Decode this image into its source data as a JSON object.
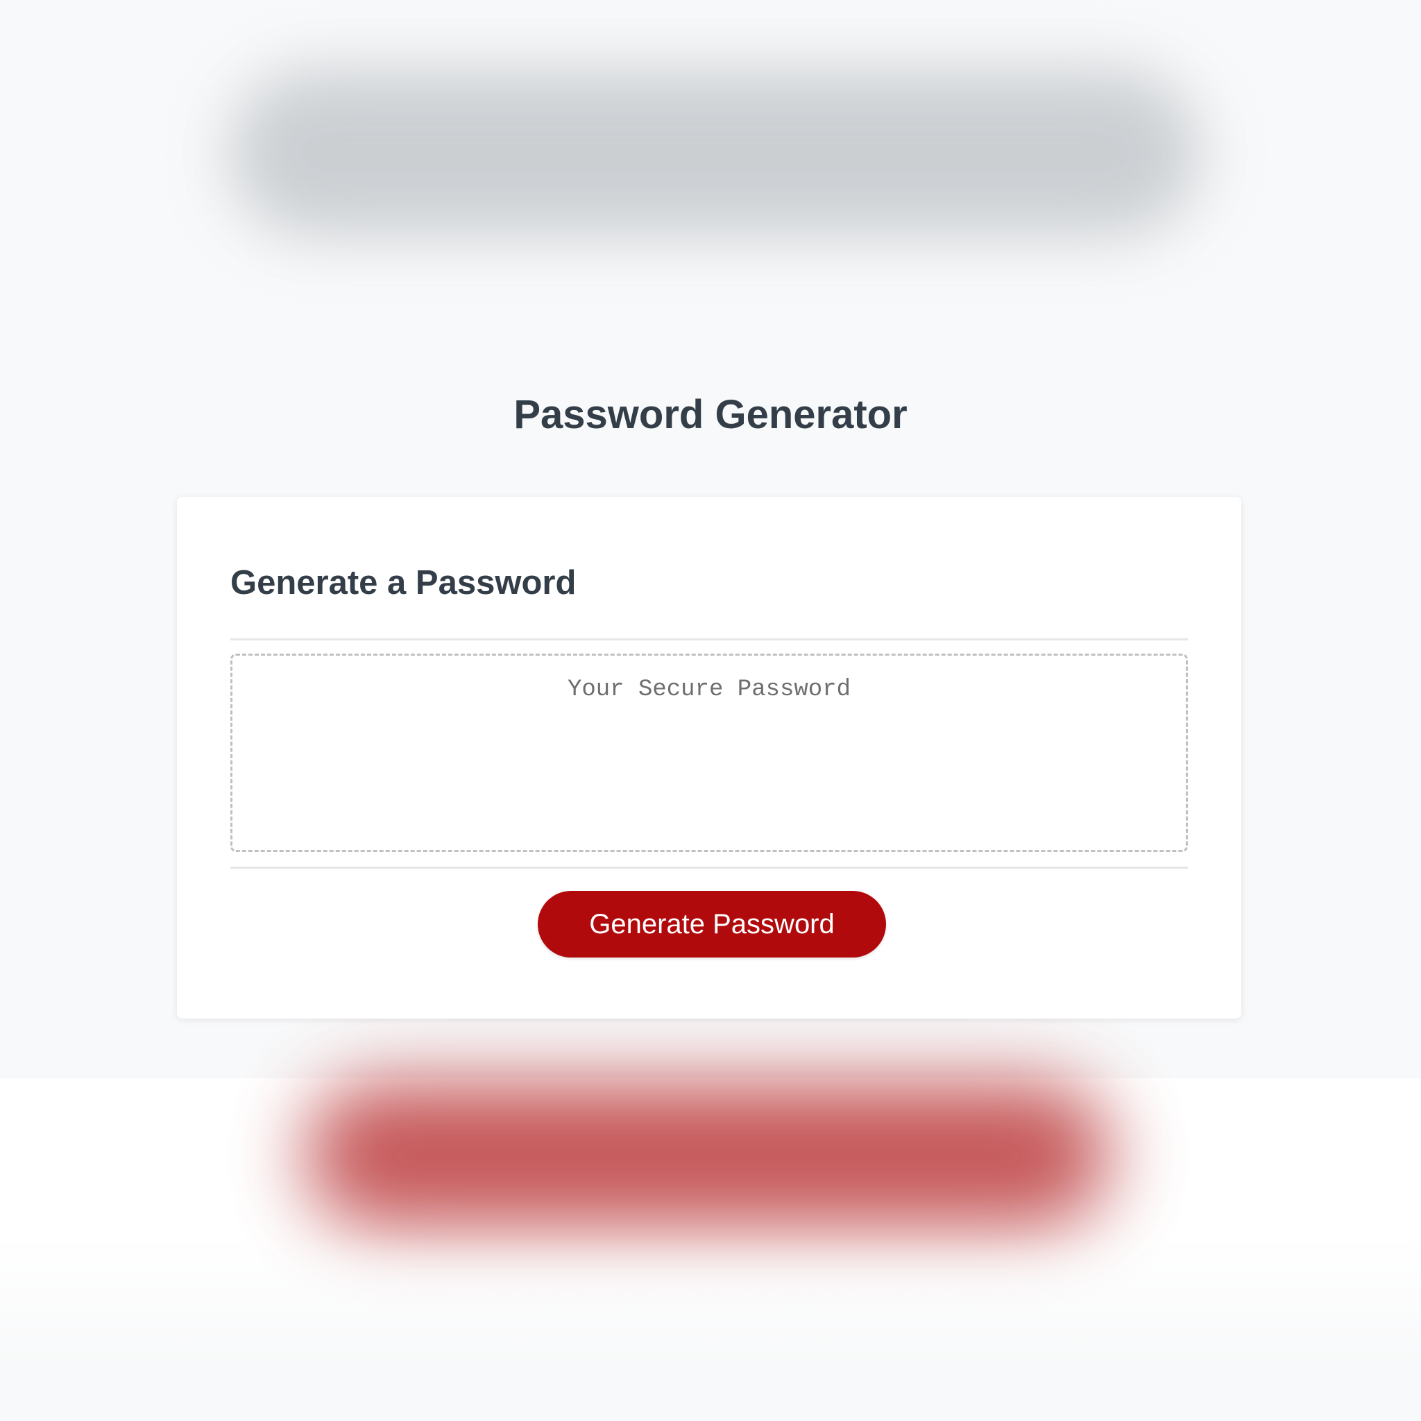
{
  "header": {
    "title": "Password Generator"
  },
  "card": {
    "title": "Generate a Password",
    "password_value": "",
    "password_placeholder": "Your Secure Password",
    "generate_label": "Generate Password"
  },
  "colors": {
    "page_background": "#f8f9fa",
    "card_background": "#ffffff",
    "heading_text": "#333e48",
    "accent": "#b00a0c",
    "dashed_border": "#c0c0c0"
  }
}
